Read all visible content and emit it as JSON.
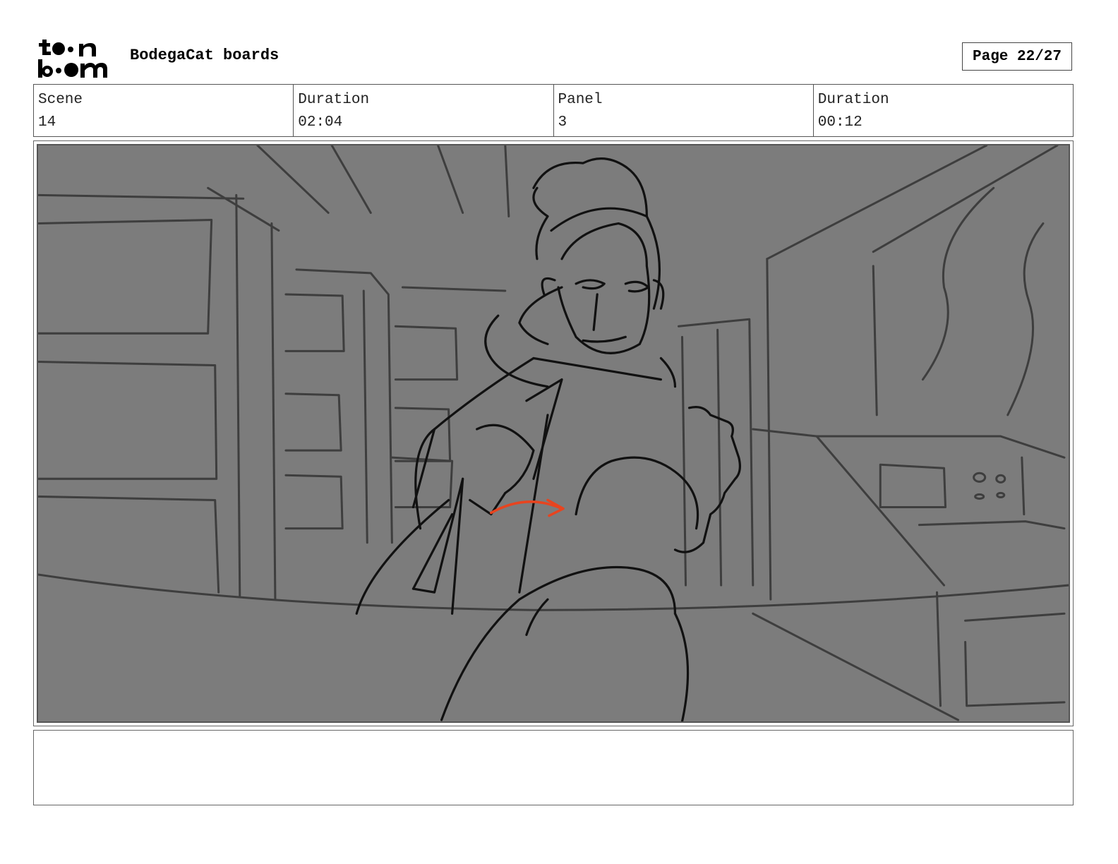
{
  "header": {
    "logo_text": "toon boom",
    "project_title": "BodegaCat boards",
    "page_label": "Page 22/27"
  },
  "info": {
    "scene_label": "Scene",
    "scene_value": "14",
    "scene_duration_label": "Duration",
    "scene_duration_value": "02:04",
    "panel_label": "Panel",
    "panel_value": "3",
    "panel_duration_label": "Duration",
    "panel_duration_value": "00:12"
  },
  "notes": {
    "text": ""
  }
}
